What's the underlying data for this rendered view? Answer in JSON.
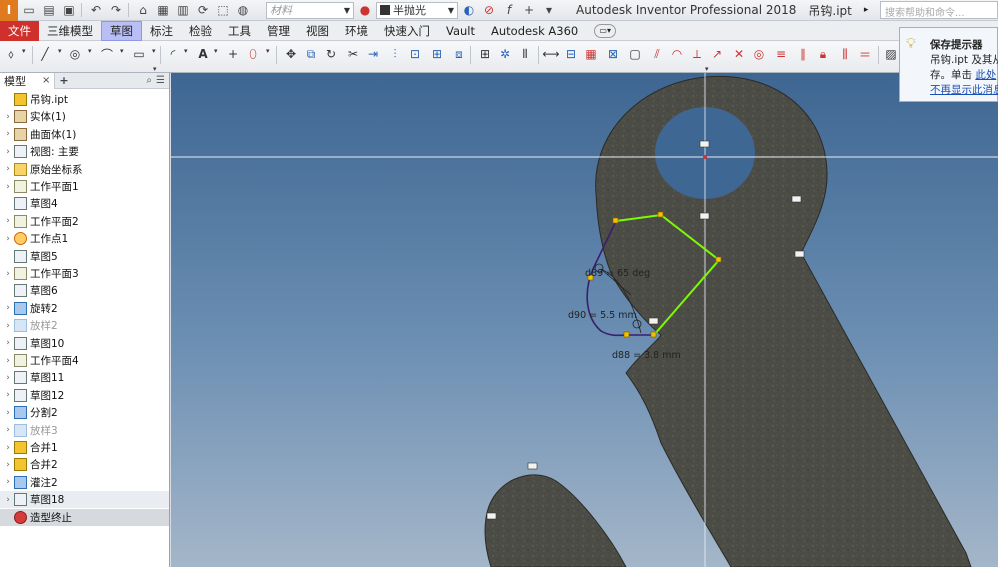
{
  "window": {
    "app_title": "Autodesk Inventor Professional 2018",
    "file_name": "吊钩.ipt",
    "search_placeholder": "搜索帮助和命令...",
    "logo_text": "I"
  },
  "quick_access": {
    "material_placeholder": "材料",
    "appearance_value": "半抛光"
  },
  "tabs": [
    {
      "label": "文件"
    },
    {
      "label": "三维模型"
    },
    {
      "label": "草图"
    },
    {
      "label": "标注"
    },
    {
      "label": "检验"
    },
    {
      "label": "工具"
    },
    {
      "label": "管理"
    },
    {
      "label": "视图"
    },
    {
      "label": "环境"
    },
    {
      "label": "快速入门"
    },
    {
      "label": "Vault"
    },
    {
      "label": "Autodesk A360"
    }
  ],
  "active_tab": "草图",
  "browser": {
    "tab_label": "模型",
    "close_glyph": "×",
    "add_glyph": "+",
    "items": [
      {
        "label": "吊钩.ipt",
        "icon": "part-icon",
        "expander": ""
      },
      {
        "label": "实体(1)",
        "icon": "solid-icon",
        "expander": "›"
      },
      {
        "label": "曲面体(1)",
        "icon": "surface-icon",
        "expander": "›"
      },
      {
        "label": "视图: 主要",
        "icon": "view-icon",
        "expander": "›"
      },
      {
        "label": "原始坐标系",
        "icon": "folder-icon",
        "expander": "›"
      },
      {
        "label": "工作平面1",
        "icon": "work-plane-icon",
        "expander": "›"
      },
      {
        "label": "草图4",
        "icon": "sketch-icon",
        "expander": ""
      },
      {
        "label": "工作平面2",
        "icon": "work-plane-icon",
        "expander": "›"
      },
      {
        "label": "工作点1",
        "icon": "work-point-icon",
        "expander": "›"
      },
      {
        "label": "草图5",
        "icon": "sketch-icon",
        "expander": ""
      },
      {
        "label": "工作平面3",
        "icon": "work-plane-icon",
        "expander": "›"
      },
      {
        "label": "草图6",
        "icon": "sketch-icon",
        "expander": ""
      },
      {
        "label": "旋转2",
        "icon": "revolve-icon",
        "expander": "›"
      },
      {
        "label": "放样2",
        "icon": "loft-icon",
        "expander": "›",
        "disabled": true
      },
      {
        "label": "草图10",
        "icon": "sketch-icon",
        "expander": "›"
      },
      {
        "label": "工作平面4",
        "icon": "work-plane-icon",
        "expander": "›"
      },
      {
        "label": "草图11",
        "icon": "sketch-icon",
        "expander": "›"
      },
      {
        "label": "草图12",
        "icon": "sketch-icon",
        "expander": "›"
      },
      {
        "label": "分割2",
        "icon": "split-icon",
        "expander": "›"
      },
      {
        "label": "放样3",
        "icon": "loft-icon",
        "expander": "›",
        "disabled": true
      },
      {
        "label": "合并1",
        "icon": "combine-icon",
        "expander": "›"
      },
      {
        "label": "合并2",
        "icon": "combine-icon",
        "expander": "›"
      },
      {
        "label": "灌注2",
        "icon": "fill-icon",
        "expander": "›"
      },
      {
        "label": "草图18",
        "icon": "sketch-icon",
        "expander": "›",
        "selected": true
      },
      {
        "label": "造型终止",
        "icon": "end-of-part-icon",
        "expander": "",
        "end": true
      }
    ]
  },
  "sketch": {
    "dim_angle": "d89 = 65 deg",
    "dim_radius": "d90 = 5.5 mm",
    "dim_length": "d88 = 3.8 mm"
  },
  "tooltip": {
    "title": "保存提示器",
    "line1": "吊钩.ipt 及其从",
    "line2_prefix": "存。单击",
    "line2_link": "此处",
    "line3": "不再显示此消息"
  },
  "colors": {
    "file_tab": "#d0302c",
    "active_tab": "#b9bff5",
    "canvas_top": "#3e6692",
    "canvas_bottom": "#a4b6c9",
    "part_fill": "#4f4f4a",
    "sketch_green": "#7cfc00",
    "sketch_purple": "#3a1e6e",
    "point_yellow": "#f2c200"
  }
}
